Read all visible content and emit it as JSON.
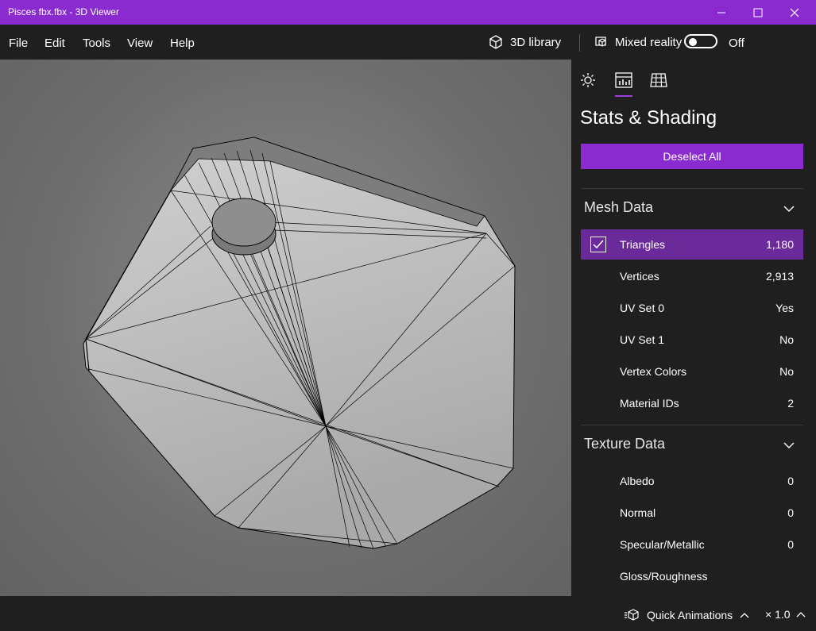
{
  "window": {
    "title": "Pisces fbx.fbx - 3D Viewer"
  },
  "menu": {
    "file": "File",
    "edit": "Edit",
    "tools": "Tools",
    "view": "View",
    "help": "Help"
  },
  "toolbar": {
    "library_label": "3D library",
    "mixed_reality_label": "Mixed reality",
    "toggle_state": "Off"
  },
  "panel": {
    "tabs": [
      "lighting-icon",
      "stats-icon",
      "grid-icon"
    ],
    "active_tab": "stats",
    "title": "Stats & Shading",
    "deselect_label": "Deselect All",
    "mesh_section": "Mesh Data",
    "mesh_rows": [
      {
        "label": "Triangles",
        "value": "1,180",
        "selected": true
      },
      {
        "label": "Vertices",
        "value": "2,913"
      },
      {
        "label": "UV Set 0",
        "value": "Yes"
      },
      {
        "label": "UV Set 1",
        "value": "No"
      },
      {
        "label": "Vertex Colors",
        "value": "No"
      },
      {
        "label": "Material IDs",
        "value": "2"
      }
    ],
    "texture_section": "Texture Data",
    "texture_rows": [
      {
        "label": "Albedo",
        "value": "0"
      },
      {
        "label": "Normal",
        "value": "0"
      },
      {
        "label": "Specular/Metallic",
        "value": "0"
      },
      {
        "label": "Gloss/Roughness",
        "value": ""
      }
    ]
  },
  "statusbar": {
    "quick_animations": "Quick Animations",
    "speed": "× 1.0"
  },
  "colors": {
    "accent": "#8a2bd0",
    "selected_row": "#6a2a9a",
    "background": "#1f1f1f"
  }
}
